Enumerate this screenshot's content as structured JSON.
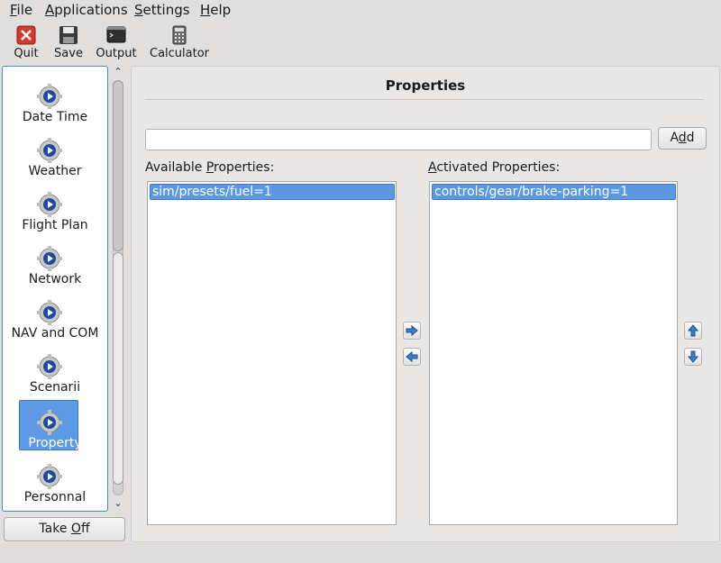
{
  "menubar": {
    "items": [
      {
        "label": "File",
        "mnemonic": "F",
        "rest": "ile"
      },
      {
        "label": "Applications",
        "mnemonic": "A",
        "rest": "pplications"
      },
      {
        "label": "Settings",
        "mnemonic": "S",
        "rest": "ettings"
      },
      {
        "label": "Help",
        "mnemonic": "H",
        "rest": "elp"
      }
    ]
  },
  "toolbar": {
    "quit_label": "Quit",
    "save_label": "Save",
    "output_label": "Output",
    "calculator_label": "Calculator"
  },
  "sidebar": {
    "items": [
      {
        "label": "Date Time",
        "icon": "gear-play-icon"
      },
      {
        "label": "Weather",
        "icon": "gear-play-icon"
      },
      {
        "label": "Flight Plan",
        "icon": "gear-play-icon"
      },
      {
        "label": "Network",
        "icon": "gear-play-icon"
      },
      {
        "label": "NAV and COM",
        "icon": "gear-play-icon"
      },
      {
        "label": "Scenarii",
        "icon": "gear-play-icon"
      },
      {
        "label": "Property",
        "icon": "gear-play-icon",
        "selected": true
      },
      {
        "label": "Personnal",
        "icon": "gear-play-icon"
      }
    ]
  },
  "takeoff": {
    "pre": "Take ",
    "mnemonic": "O",
    "post": "ff"
  },
  "panel": {
    "title": "Properties",
    "input_value": "",
    "add_pre": "A",
    "add_mnemonic": "d",
    "add_post": "d",
    "available_pre": "Available ",
    "available_mnemonic": "P",
    "available_post": "roperties:",
    "activated_pre": "",
    "activated_mnemonic": "A",
    "activated_post": "ctivated Properties:",
    "available_items": [
      "sim/presets/fuel=1"
    ],
    "activated_items": [
      "controls/gear/brake-parking=1"
    ]
  },
  "colors": {
    "selection": "#5b98e0",
    "sidebar_border": "#4f86c6"
  }
}
